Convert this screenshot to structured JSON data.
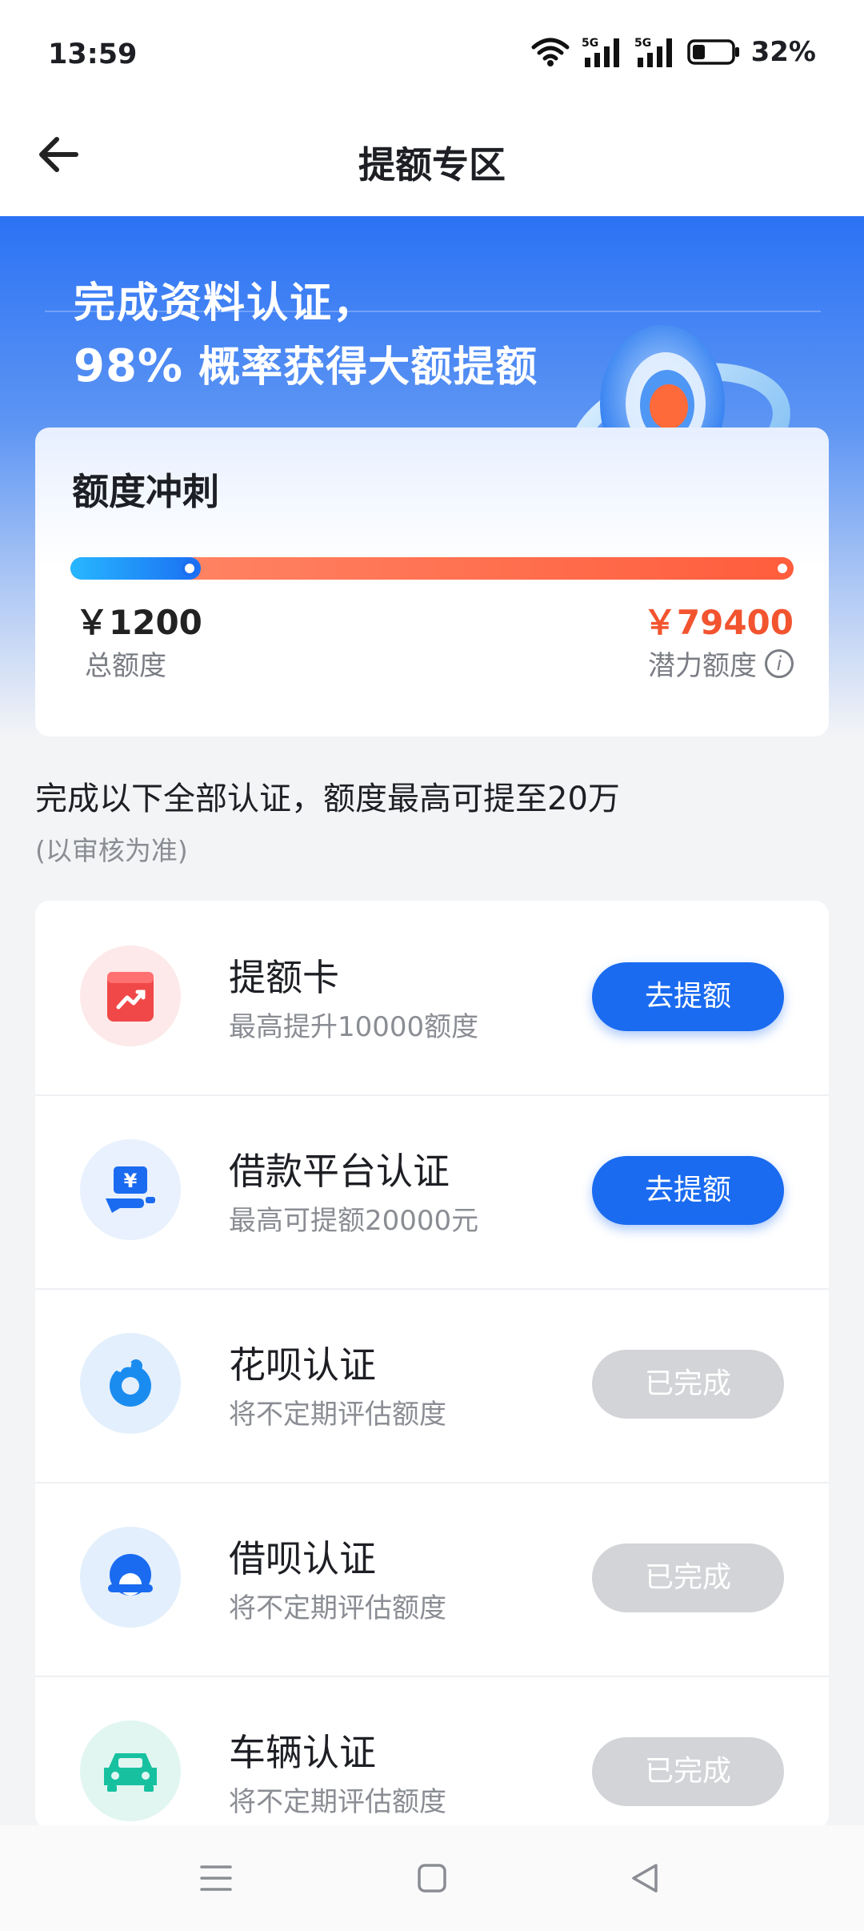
{
  "status_bar": {
    "time": "13:59",
    "battery_percent": "32%",
    "battery_level": 0.32,
    "icons": [
      "wifi-icon",
      "signal-5g-icon",
      "signal-5g-icon",
      "battery-icon"
    ]
  },
  "nav": {
    "title": "提额专区",
    "back_icon": "arrow-left-icon"
  },
  "hero": {
    "line1": "完成资料认证，",
    "percent": "98%",
    "line2_rest": " 概率获得大额提额",
    "graphic_icon": "target-ring-icon"
  },
  "quota": {
    "title": "额度冲刺",
    "total_amount": "￥1200",
    "total_label": "总额度",
    "potential_amount": "￥79400",
    "potential_label": "潜力额度",
    "progress_fraction": 0.18,
    "info_icon": "info-icon"
  },
  "section": {
    "title": "完成以下全部认证，额度最高可提至20万",
    "note": "(以审核为准)"
  },
  "items": [
    {
      "title": "提额卡",
      "subtitle": "最高提升10000额度",
      "button": "去提额",
      "state": "active",
      "icon": "red-card-chart-icon",
      "icon_color": "#f04848",
      "icon_bg": "#fde9e9"
    },
    {
      "title": "借款平台认证",
      "subtitle": "最高可提额20000元",
      "button": "去提额",
      "state": "active",
      "icon": "yuan-hand-icon",
      "icon_color": "#1a6bf0",
      "icon_bg": "#e8f1fd"
    },
    {
      "title": "花呗认证",
      "subtitle": "将不定期评估额度",
      "button": "已完成",
      "state": "done",
      "icon": "huabei-icon",
      "icon_color": "#1a8cf0",
      "icon_bg": "#e3effc"
    },
    {
      "title": "借呗认证",
      "subtitle": "将不定期评估额度",
      "button": "已完成",
      "state": "done",
      "icon": "jiebei-icon",
      "icon_color": "#1a6bf0",
      "icon_bg": "#e3effc"
    },
    {
      "title": "车辆认证",
      "subtitle": "将不定期评估额度",
      "button": "已完成",
      "state": "done",
      "icon": "car-icon",
      "icon_color": "#17c1a0",
      "icon_bg": "#e1f6f1"
    }
  ],
  "colors": {
    "accent": "#1a6bf0",
    "orange": "#f2542f",
    "done_gray": "#d3d4d7"
  },
  "system_nav": [
    "menu-icon",
    "home-square-icon",
    "back-triangle-icon"
  ]
}
